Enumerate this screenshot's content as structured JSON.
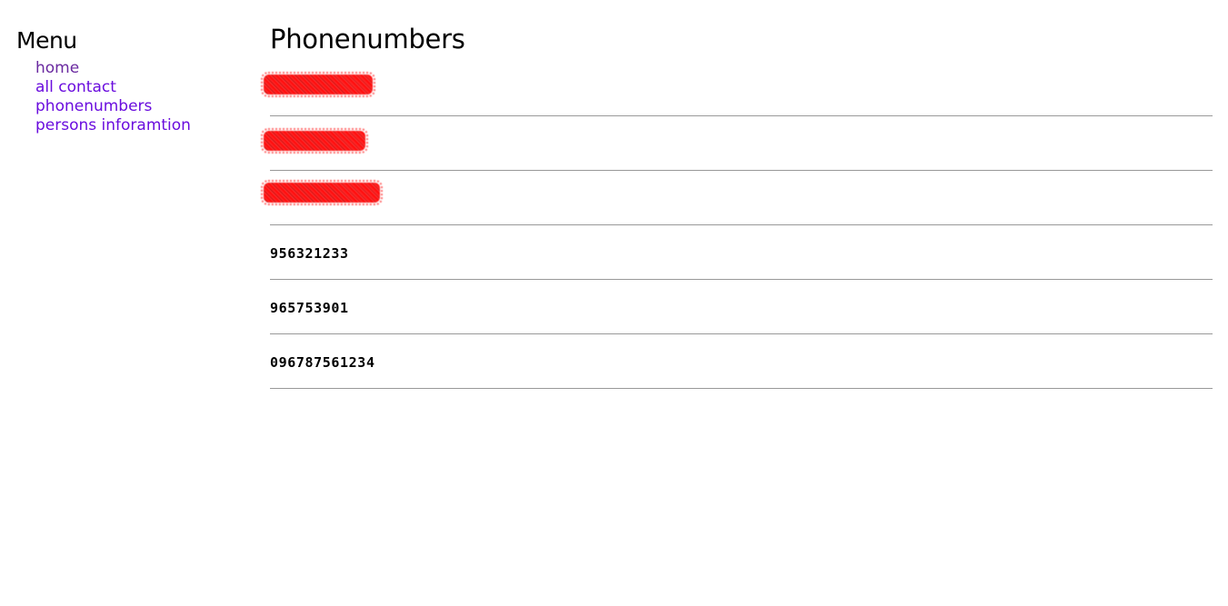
{
  "sidebar": {
    "title": "Menu",
    "items": [
      {
        "label": "home"
      },
      {
        "label": "all contact"
      },
      {
        "label": "phonenumbers"
      },
      {
        "label": "persons inforamtion"
      }
    ]
  },
  "main": {
    "title": "Phonenumbers",
    "phones": [
      {
        "number": "",
        "redacted": true
      },
      {
        "number": "",
        "redacted": true
      },
      {
        "number": "",
        "redacted": true
      },
      {
        "number": "956321233",
        "redacted": false
      },
      {
        "number": "965753901",
        "redacted": false
      },
      {
        "number": "096787561234",
        "redacted": false
      }
    ]
  },
  "colors": {
    "link": "#6a0dde",
    "link_visited": "#6a2aa0",
    "divider": "#999999",
    "redaction": "#ff0000"
  }
}
